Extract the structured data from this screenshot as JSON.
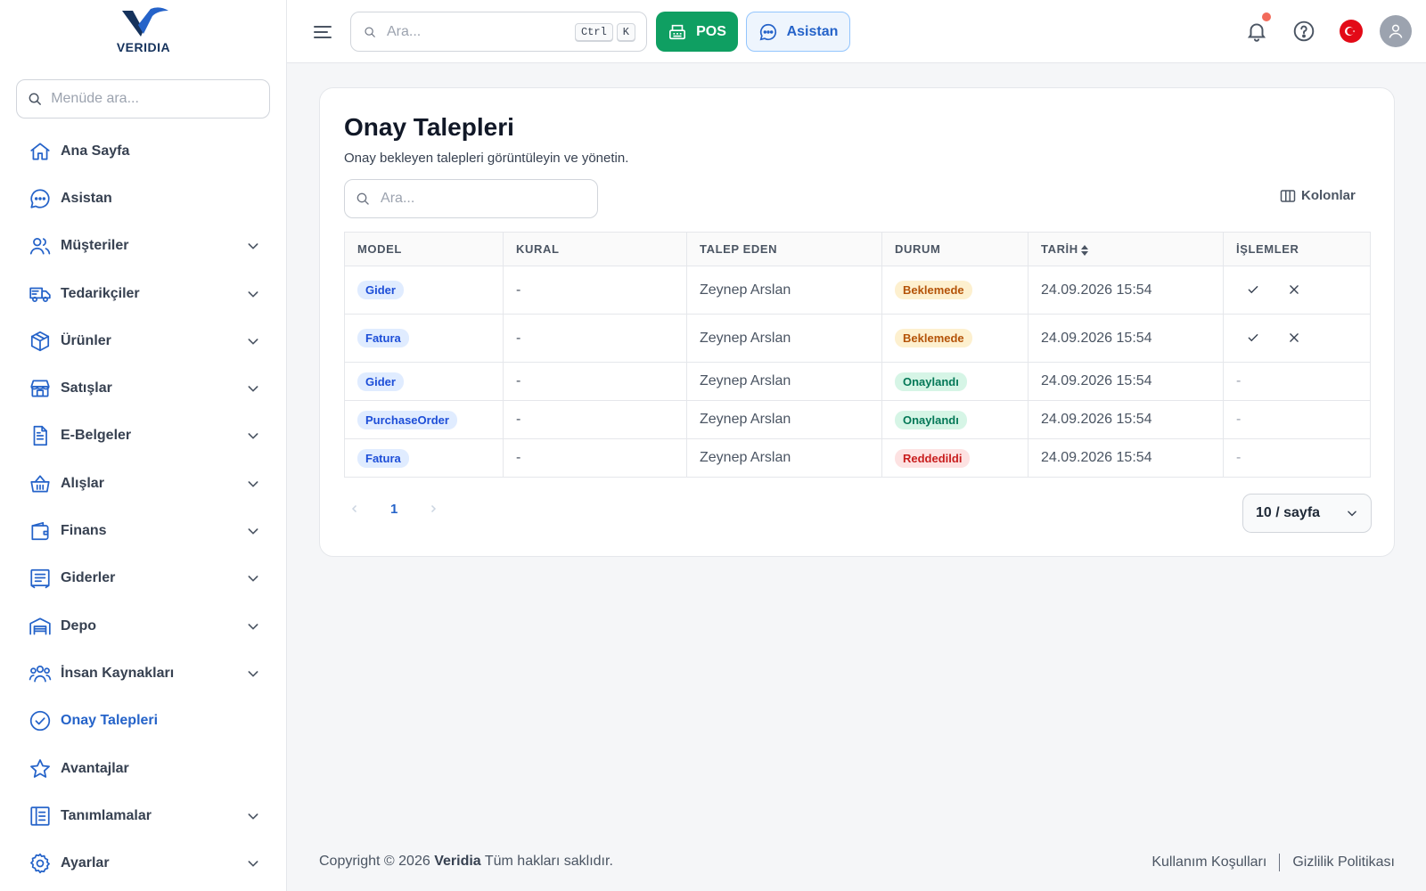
{
  "brand": {
    "name": "VERIDIA",
    "primary": "#2563c9",
    "dark": "#15325c",
    "green": "#0f9f62"
  },
  "sidebar": {
    "search_placeholder": "Menüde ara...",
    "items": [
      {
        "label": "Ana Sayfa",
        "icon": "home-icon",
        "expandable": false,
        "active": false
      },
      {
        "label": "Asistan",
        "icon": "chat-icon",
        "expandable": false,
        "active": false
      },
      {
        "label": "Müşteriler",
        "icon": "users-icon",
        "expandable": true,
        "active": false
      },
      {
        "label": "Tedarikçiler",
        "icon": "truck-icon",
        "expandable": true,
        "active": false
      },
      {
        "label": "Ürünler",
        "icon": "box-icon",
        "expandable": true,
        "active": false
      },
      {
        "label": "Satışlar",
        "icon": "store-icon",
        "expandable": true,
        "active": false
      },
      {
        "label": "E-Belgeler",
        "icon": "document-icon",
        "expandable": true,
        "active": false
      },
      {
        "label": "Alışlar",
        "icon": "basket-icon",
        "expandable": true,
        "active": false
      },
      {
        "label": "Finans",
        "icon": "wallet-icon",
        "expandable": true,
        "active": false
      },
      {
        "label": "Giderler",
        "icon": "receipt-icon",
        "expandable": true,
        "active": false
      },
      {
        "label": "Depo",
        "icon": "warehouse-icon",
        "expandable": true,
        "active": false
      },
      {
        "label": "İnsan Kaynakları",
        "icon": "team-icon",
        "expandable": true,
        "active": false
      },
      {
        "label": "Onay Talepleri",
        "icon": "check-circle-icon",
        "expandable": false,
        "active": true
      },
      {
        "label": "Avantajlar",
        "icon": "star-icon",
        "expandable": false,
        "active": false
      },
      {
        "label": "Tanımlamalar",
        "icon": "list-icon",
        "expandable": true,
        "active": false
      },
      {
        "label": "Ayarlar",
        "icon": "gear-icon",
        "expandable": true,
        "active": false
      }
    ]
  },
  "header": {
    "search_placeholder": "Ara...",
    "kbd_ctrl": "Ctrl",
    "kbd_k": "K",
    "pos_label": "POS",
    "assistant_label": "Asistan"
  },
  "main": {
    "title": "Onay Talepleri",
    "subtitle": "Onay bekleyen talepleri görüntüleyin ve yönetin.",
    "search_placeholder": "Ara...",
    "columns_button": "Kolonlar",
    "table": {
      "headers": [
        "MODEL",
        "KURAL",
        "TALEP EDEN",
        "DURUM",
        "TARİH",
        "İŞLEMLER"
      ],
      "rows": [
        {
          "model": "Gider",
          "rule": "-",
          "requester": "Zeynep Arslan",
          "status": "Beklemede",
          "status_type": "pending",
          "date": "24.09.2026 15:54",
          "actions": true
        },
        {
          "model": "Fatura",
          "rule": "-",
          "requester": "Zeynep Arslan",
          "status": "Beklemede",
          "status_type": "pending",
          "date": "24.09.2026 15:54",
          "actions": true
        },
        {
          "model": "Gider",
          "rule": "-",
          "requester": "Zeynep Arslan",
          "status": "Onaylandı",
          "status_type": "approved",
          "date": "24.09.2026 15:54",
          "actions": false
        },
        {
          "model": "PurchaseOrder",
          "rule": "-",
          "requester": "Zeynep Arslan",
          "status": "Onaylandı",
          "status_type": "approved",
          "date": "24.09.2026 15:54",
          "actions": false
        },
        {
          "model": "Fatura",
          "rule": "-",
          "requester": "Zeynep Arslan",
          "status": "Reddedildi",
          "status_type": "rejected",
          "date": "24.09.2026 15:54",
          "actions": false
        }
      ],
      "no_action_text": "-"
    },
    "pagination": {
      "current_page": "1",
      "page_size": "10 / sayfa"
    }
  },
  "footer": {
    "copyright_prefix": "Copyright © 2026",
    "copyright_brand": "Veridia",
    "copyright_suffix": "Tüm hakları saklıdır.",
    "terms": "Kullanım Koşulları",
    "privacy": "Gizlilik Politikası"
  }
}
